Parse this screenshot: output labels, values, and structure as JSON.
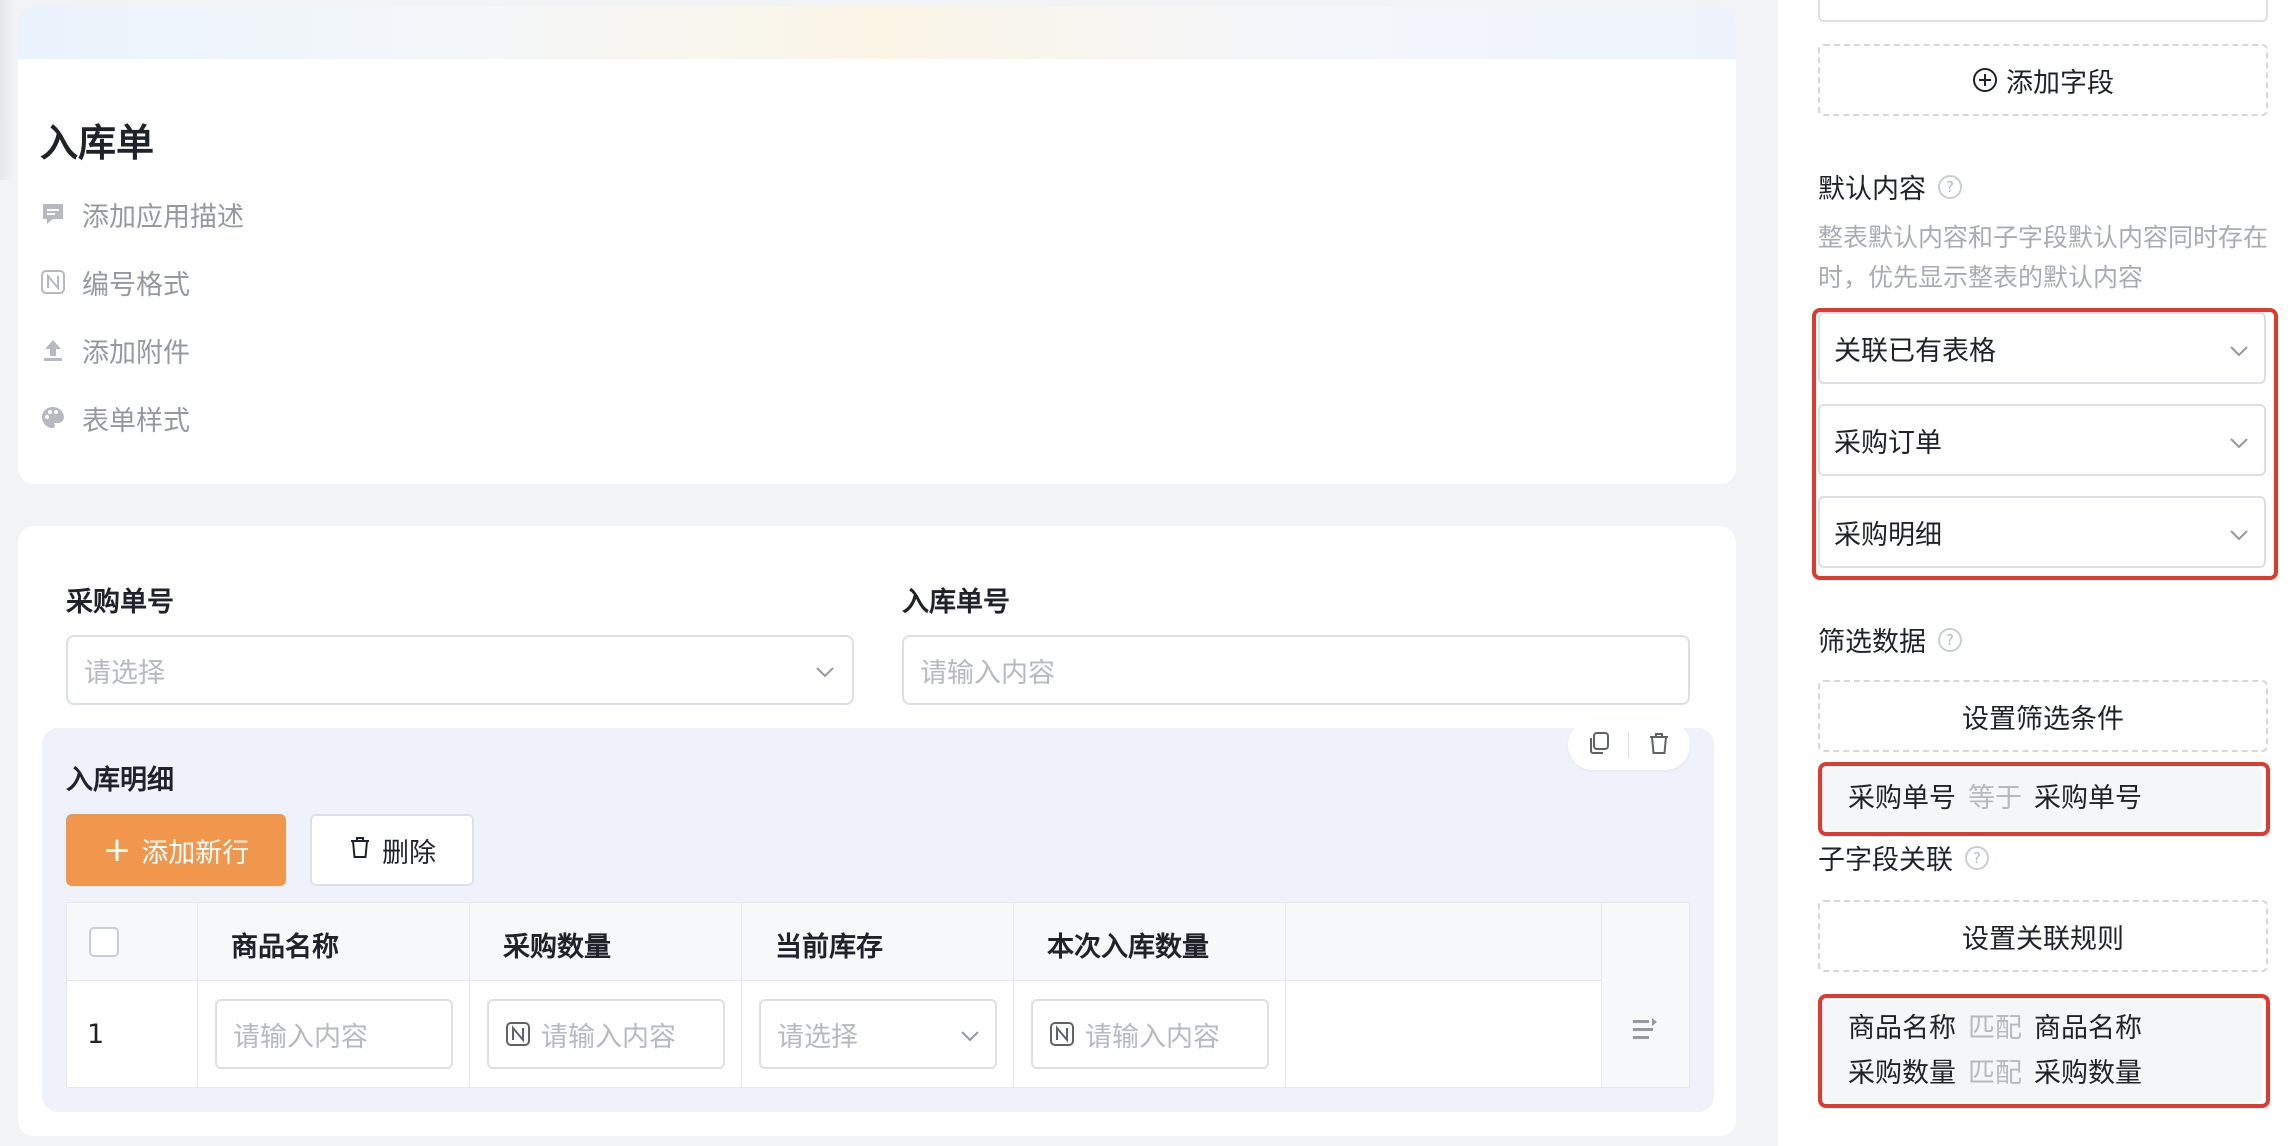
{
  "form": {
    "title": "入库单",
    "options": [
      {
        "label": "添加应用描述",
        "icon": "comment-icon"
      },
      {
        "label": "编号格式",
        "icon": "number-format-icon"
      },
      {
        "label": "添加附件",
        "icon": "upload-icon"
      },
      {
        "label": "表单样式",
        "icon": "palette-icon"
      }
    ]
  },
  "fields": {
    "purchase_no": {
      "label": "采购单号",
      "placeholder": "请选择"
    },
    "inbound_no": {
      "label": "入库单号",
      "placeholder": "请输入内容"
    }
  },
  "subform": {
    "title": "入库明细",
    "add_row_label": "添加新行",
    "delete_label": "删除",
    "columns": [
      "商品名称",
      "采购数量",
      "当前库存",
      "本次入库数量"
    ],
    "rows": [
      {
        "index": "1",
        "cells": [
          "请输入内容",
          "请输入内容",
          "请选择",
          "请输入内容"
        ]
      }
    ]
  },
  "panel": {
    "add_field_label": "添加字段",
    "default_content": {
      "title": "默认内容",
      "help": "?",
      "description": "整表默认内容和子字段默认内容同时存在时，优先显示整表的默认内容",
      "selects": [
        "关联已有表格",
        "采购订单",
        "采购明细"
      ]
    },
    "filter": {
      "title": "筛选数据",
      "help": "?",
      "button_label": "设置筛选条件",
      "condition": {
        "left": "采购单号",
        "op": "等于",
        "right": "采购单号"
      }
    },
    "subfield_link": {
      "title": "子字段关联",
      "help": "?",
      "button_label": "设置关联规则",
      "rules": [
        {
          "left": "商品名称",
          "op": "匹配",
          "right": "商品名称"
        },
        {
          "left": "采购数量",
          "op": "匹配",
          "right": "采购数量"
        }
      ]
    }
  },
  "colors": {
    "accent_orange": "#f0974d",
    "highlight_red": "#e03a2e"
  }
}
